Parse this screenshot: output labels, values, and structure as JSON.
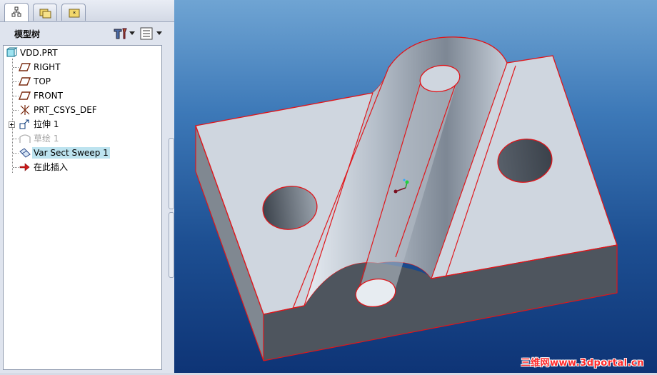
{
  "panel": {
    "title": "模型树",
    "tabs": [
      {
        "icon": "model-tree-icon",
        "active": true
      },
      {
        "icon": "folder-browser-icon",
        "active": false
      },
      {
        "icon": "favorites-icon",
        "active": false
      }
    ],
    "settings_button_icon": "tree-settings-icon",
    "show_button_icon": "tree-show-icon"
  },
  "tree": {
    "root": "VDD.PRT",
    "items": [
      {
        "label": "RIGHT",
        "icon": "datum-plane-icon"
      },
      {
        "label": "TOP",
        "icon": "datum-plane-icon"
      },
      {
        "label": "FRONT",
        "icon": "datum-plane-icon"
      },
      {
        "label": "PRT_CSYS_DEF",
        "icon": "coordinate-system-icon"
      },
      {
        "label": "拉伸 1",
        "icon": "extrude-icon"
      },
      {
        "label": "草绘 1",
        "icon": "sketch-icon",
        "suppressed": true
      },
      {
        "label": "Var Sect Sweep 1",
        "icon": "var-sect-sweep-icon",
        "selected": true
      },
      {
        "label": "在此插入",
        "icon": "insert-here-arrow-icon"
      }
    ]
  },
  "viewport": {
    "watermark": "三维网www.3dportal.cn",
    "colors": {
      "background_top": "#6fa4d3",
      "background_bottom": "#0e3476",
      "edge_highlight": "#e0161b",
      "model_top": "#cfd6df"
    }
  }
}
